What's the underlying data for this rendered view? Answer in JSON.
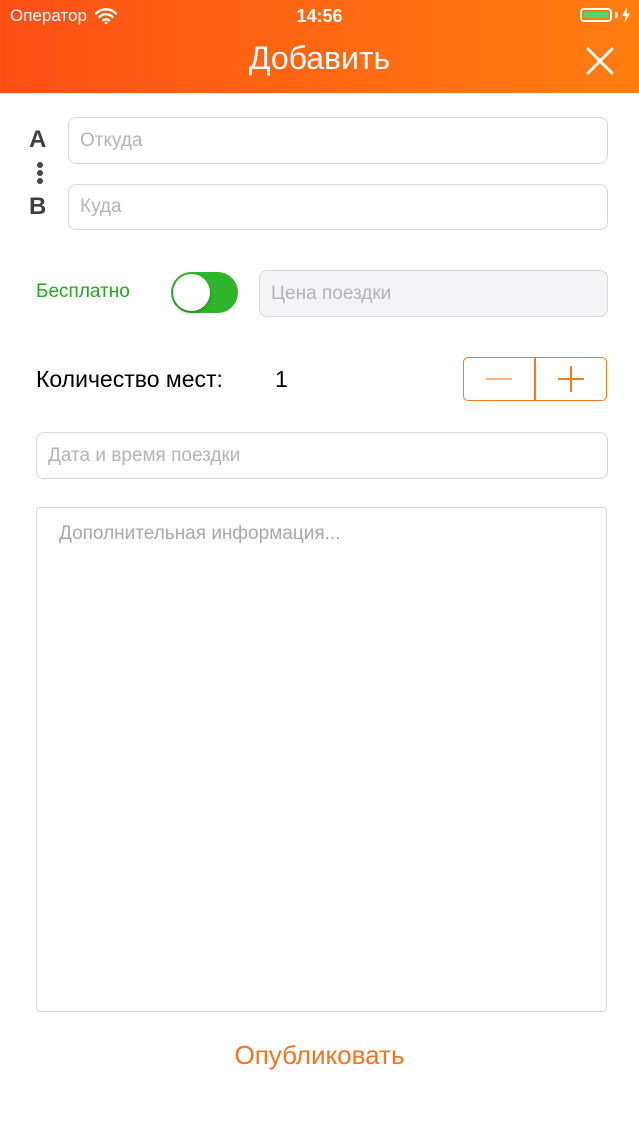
{
  "status_bar": {
    "carrier": "Оператор",
    "time": "14:56",
    "wifi_icon": "wifi-icon",
    "battery_icon": "battery-icon",
    "charging_icon": "charging-bolt-icon",
    "battery_level": 1.0,
    "battery_color": "#4cd964"
  },
  "header": {
    "title": "Добавить",
    "close_icon": "close-icon",
    "gradient_colors": [
      "#fd4f15",
      "#ff7d0f"
    ]
  },
  "route": {
    "from_marker": "A",
    "to_marker": "B",
    "from_placeholder": "Откуда",
    "from_value": "",
    "to_placeholder": "Куда",
    "to_value": ""
  },
  "price": {
    "free_label": "Бесплатно",
    "free_enabled": true,
    "toggle_color": "#2fb52b",
    "free_label_color": "#24a61f",
    "price_placeholder": "Цена поездки",
    "price_value": ""
  },
  "seats": {
    "label": "Количество мест:",
    "value": "1",
    "minus_icon": "minus-icon",
    "plus_icon": "plus-icon",
    "accent_color": "#f47b20"
  },
  "datetime": {
    "placeholder": "Дата и время поездки",
    "value": ""
  },
  "info": {
    "placeholder": "Дополнительная информация...",
    "value": ""
  },
  "actions": {
    "publish_label": "Опубликовать",
    "publish_color": "#f37320"
  }
}
